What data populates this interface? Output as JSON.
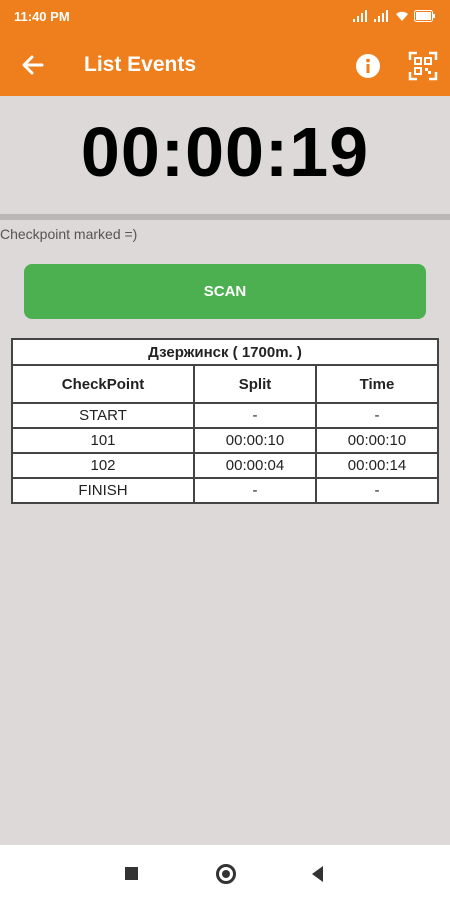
{
  "status_bar": {
    "time": "11:40 PM",
    "battery_icon": "battery-icon",
    "signal_icon": "signal-icon",
    "wifi_icon": "wifi-icon"
  },
  "app_bar": {
    "title": "List Events",
    "back_icon": "back-arrow-icon",
    "info_icon": "info-icon",
    "qr_icon": "qr-scan-icon",
    "color": "#ee7f1c"
  },
  "timer": {
    "value": "00:00:19"
  },
  "message": "Checkpoint marked =)",
  "scan_button": {
    "label": "SCAN",
    "color": "#4caf50"
  },
  "table": {
    "caption": "Дзержинск ( 1700m. )",
    "headers": [
      "CheckPoint",
      "Split",
      "Time"
    ],
    "rows": [
      [
        "START",
        "-",
        "-"
      ],
      [
        "101",
        "00:00:10",
        "00:00:10"
      ],
      [
        "102",
        "00:00:04",
        "00:00:14"
      ],
      [
        "FINISH",
        "-",
        "-"
      ]
    ]
  },
  "nav_bar": {
    "recents_icon": "square-icon",
    "home_icon": "home-circle-icon",
    "back_icon": "back-triangle-icon"
  }
}
